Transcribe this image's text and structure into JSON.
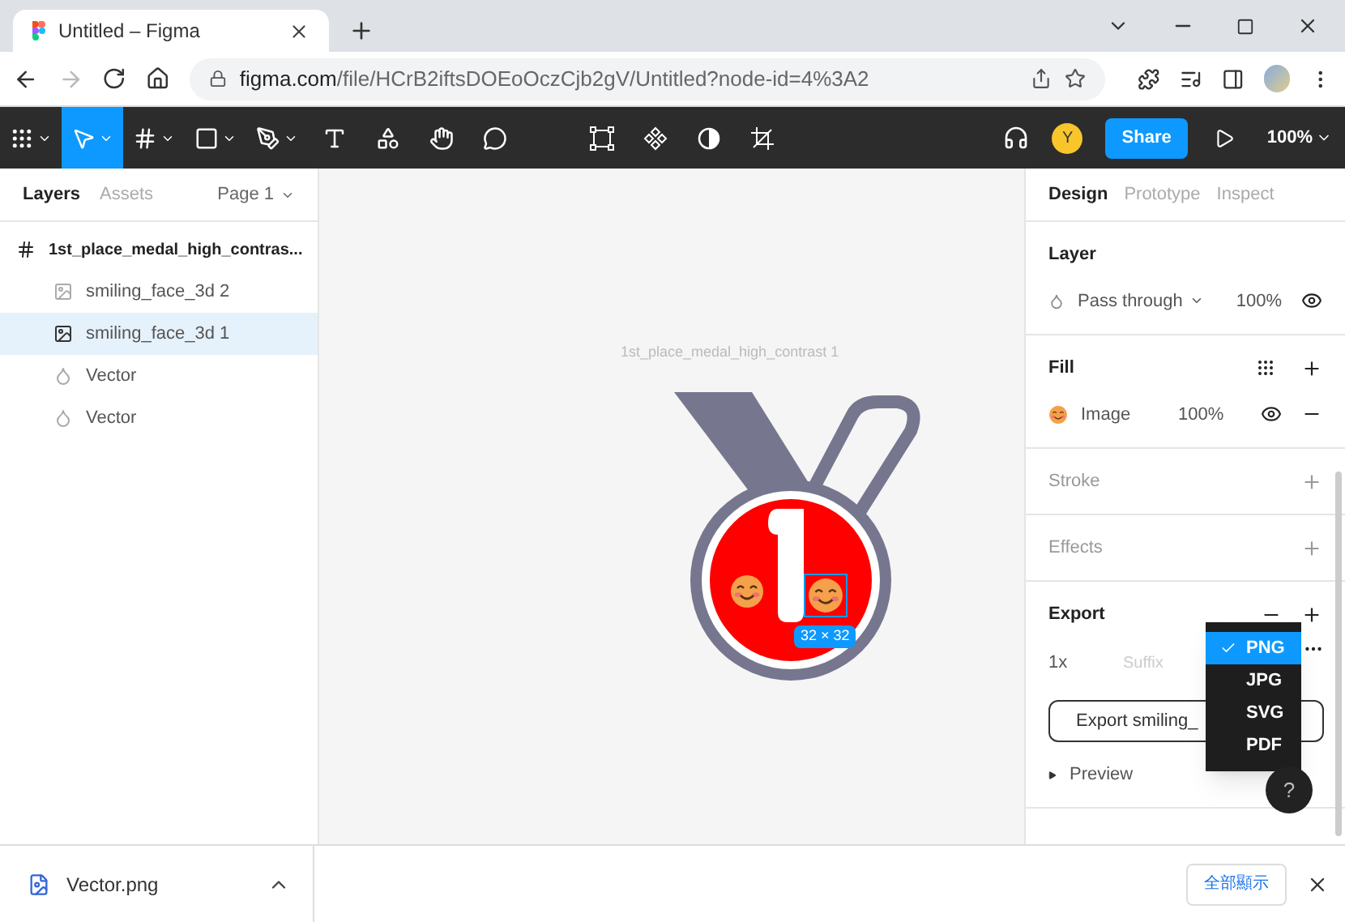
{
  "browser": {
    "tab_title": "Untitled – Figma",
    "url_host": "figma.com",
    "url_path": "/file/HCrB2iftsDOEoOczCjb2gV/Untitled?node-id=4%3A2"
  },
  "toolbar": {
    "tools": [
      {
        "kind": "main-menu",
        "selected": false
      },
      {
        "kind": "move",
        "selected": true
      },
      {
        "kind": "frame",
        "selected": false
      },
      {
        "kind": "shape",
        "selected": false
      },
      {
        "kind": "pen",
        "selected": false
      },
      {
        "kind": "text",
        "selected": false
      },
      {
        "kind": "resources",
        "selected": false
      },
      {
        "kind": "hand",
        "selected": false
      },
      {
        "kind": "comment",
        "selected": false
      }
    ],
    "avatar": "Y",
    "share": "Share",
    "zoom": "100%"
  },
  "left_panel": {
    "tabs": [
      {
        "label": "Layers",
        "selected": true
      },
      {
        "label": "Assets",
        "selected": false
      }
    ],
    "page": "Page 1",
    "layers": [
      {
        "kind": "frame",
        "name": "1st_place_medal_high_contras...",
        "selected": false,
        "children": [
          {
            "kind": "image",
            "name": "smiling_face_3d 2",
            "selected": false
          },
          {
            "kind": "image",
            "name": "smiling_face_3d 1",
            "selected": true
          },
          {
            "kind": "vector",
            "name": "Vector",
            "selected": false
          },
          {
            "kind": "vector",
            "name": "Vector",
            "selected": false
          }
        ]
      }
    ]
  },
  "canvas": {
    "frame_label": "1st_place_medal_high_contrast 1",
    "size_label": "32 × 32"
  },
  "right_panel": {
    "tabs": [
      {
        "label": "Design",
        "selected": true
      },
      {
        "label": "Prototype",
        "selected": false
      },
      {
        "label": "Inspect",
        "selected": false
      }
    ],
    "layer": {
      "title": "Layer",
      "blend": "Pass through",
      "opacity": "100%"
    },
    "fill": {
      "title": "Fill",
      "name": "Image",
      "opacity": "100%"
    },
    "stroke": {
      "title": "Stroke"
    },
    "effects": {
      "title": "Effects"
    },
    "export": {
      "title": "Export",
      "scale": "1x",
      "suffix_placeholder": "Suffix",
      "button": "Export smiling_",
      "preview": "Preview",
      "formats": [
        {
          "label": "PNG",
          "selected": true
        },
        {
          "label": "JPG",
          "selected": false
        },
        {
          "label": "SVG",
          "selected": false
        },
        {
          "label": "PDF",
          "selected": false
        }
      ]
    },
    "help": "?"
  },
  "downloads": {
    "file": "Vector.png",
    "show_all": "全部顯示"
  }
}
